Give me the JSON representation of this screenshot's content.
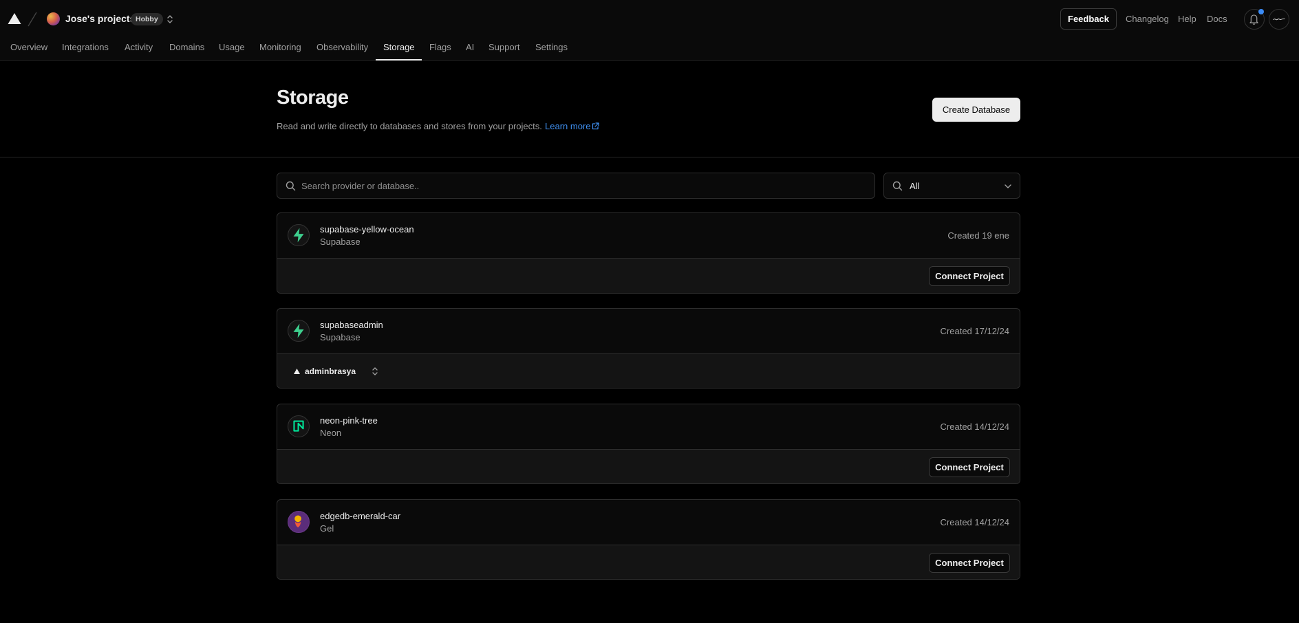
{
  "header": {
    "project_name": "Jose's projects",
    "plan_badge": "Hobby",
    "feedback_label": "Feedback",
    "links": [
      "Changelog",
      "Help",
      "Docs"
    ]
  },
  "nav": {
    "tabs": [
      "Overview",
      "Integrations",
      "Activity",
      "Domains",
      "Usage",
      "Monitoring",
      "Observability",
      "Storage",
      "Flags",
      "AI",
      "Support",
      "Settings"
    ],
    "active": "Storage"
  },
  "page": {
    "title": "Storage",
    "subtitle": "Read and write directly to databases and stores from your projects.",
    "learn_more": "Learn more",
    "create_label": "Create Database"
  },
  "filters": {
    "search_placeholder": "Search provider or database..",
    "type_value": "All"
  },
  "databases": [
    {
      "name": "supabase-yellow-ocean",
      "provider": "Supabase",
      "created": "Created 19 ene",
      "action": "Connect Project",
      "icon": "supabase-icon"
    },
    {
      "name": "supabaseadmin",
      "provider": "Supabase",
      "created": "Created 17/12/24",
      "linked_project": "adminbrasya",
      "icon": "supabase-icon"
    },
    {
      "name": "neon-pink-tree",
      "provider": "Neon",
      "created": "Created 14/12/24",
      "action": "Connect Project",
      "icon": "neon-icon"
    },
    {
      "name": "edgedb-emerald-car",
      "provider": "Gel",
      "created": "Created 14/12/24",
      "action": "Connect Project",
      "icon": "gel-icon"
    }
  ],
  "colors": {
    "background": "#000000",
    "surface": "#0a0a0a",
    "border": "#2e2e2e",
    "link": "#3f8ff0",
    "supabase": "#3ecf8e",
    "neon": "#00e599",
    "notification_dot": "#3b8bf5"
  }
}
